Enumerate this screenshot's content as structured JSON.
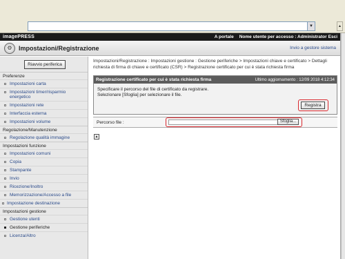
{
  "browser": {
    "address_value": ""
  },
  "topbar": {
    "brand": "imagePRESS",
    "obscured": "",
    "portal_link": "A portale",
    "user_label": "Nome utente per accesso : Administrator",
    "logout_link": "Esci"
  },
  "header": {
    "title": "Impostazioni/Registrazione",
    "system_link": "Invio a gestore sistema"
  },
  "sidebar": {
    "restart_button": "Riavvio periferica",
    "sections": [
      {
        "head": "Preferenze",
        "items": [
          "Impostazioni carta",
          "Impostazioni timer/risparmio energetico",
          "Impostazioni rete",
          "Interfaccia esterna",
          "Impostazioni volume"
        ]
      },
      {
        "head": "Regolazione/Manutenzione",
        "items": [
          "Regolazione qualità immagine"
        ]
      },
      {
        "head": "Impostazioni funzione",
        "items": [
          "Impostazioni comuni",
          "Copia",
          "Stampante",
          "Invio",
          "Ricezione/Inoltro",
          "Memorizzazione/Accesso a file"
        ]
      }
    ],
    "dest_item": "Impostazione destinazione",
    "gestione_head": "Impostazioni gestione",
    "gestione_items": [
      "Gestione utenti",
      "Gestione periferiche",
      "Licenza/Altro"
    ]
  },
  "main": {
    "breadcrumb": "Impostazioni/Registrazione : Impostazioni gestione : Gestione periferiche > Impostazioni chiave e certificato > Dettagli richiesta di firma di chiave e certificato (CSR) > Registrazione certificato per cui è stata richiesta firma",
    "panel": {
      "title": "Registrazione certificato per cui è stata richiesta firma",
      "updated": "Ultimo aggiornamento : 12/09 2018 4:12:34",
      "line1": "Specificare il percorso del file di certificato da registrare.",
      "line2": "Selezionare [Sfoglia] per selezionare il file.",
      "register_button": "Registra"
    },
    "file": {
      "label": "Percorso file :",
      "value": "",
      "browse_button": "Sfoglia..."
    }
  },
  "colors": {
    "highlight": "#d9262c",
    "topbar": "#1a1a1a",
    "link": "#2a4a8a"
  }
}
